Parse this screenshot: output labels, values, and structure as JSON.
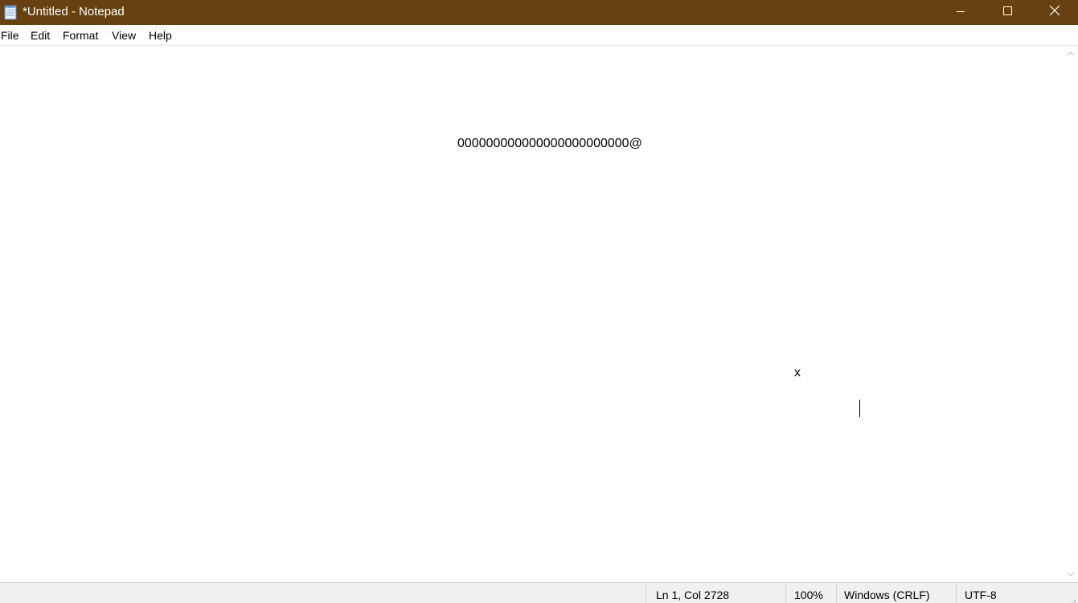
{
  "window": {
    "title": "*Untitled - Notepad",
    "titlebar_color": "#674210"
  },
  "icons": {
    "app": "notepad-icon",
    "minimize": "minimize-icon",
    "maximize": "maximize-icon",
    "close": "close-icon",
    "scroll_up": "chevron-up-icon",
    "scroll_down": "chevron-down-icon",
    "size_grip": "resize-grip-icon"
  },
  "menu": {
    "items": [
      {
        "label": "File"
      },
      {
        "label": "Edit"
      },
      {
        "label": "Format"
      },
      {
        "label": "View"
      },
      {
        "label": "Help"
      }
    ]
  },
  "editor": {
    "line1_text": "000000000000000000000000@",
    "line2_text": "x"
  },
  "status": {
    "position": "Ln 1, Col 2728",
    "zoom": "100%",
    "line_ending": "Windows (CRLF)",
    "encoding": "UTF-8"
  }
}
